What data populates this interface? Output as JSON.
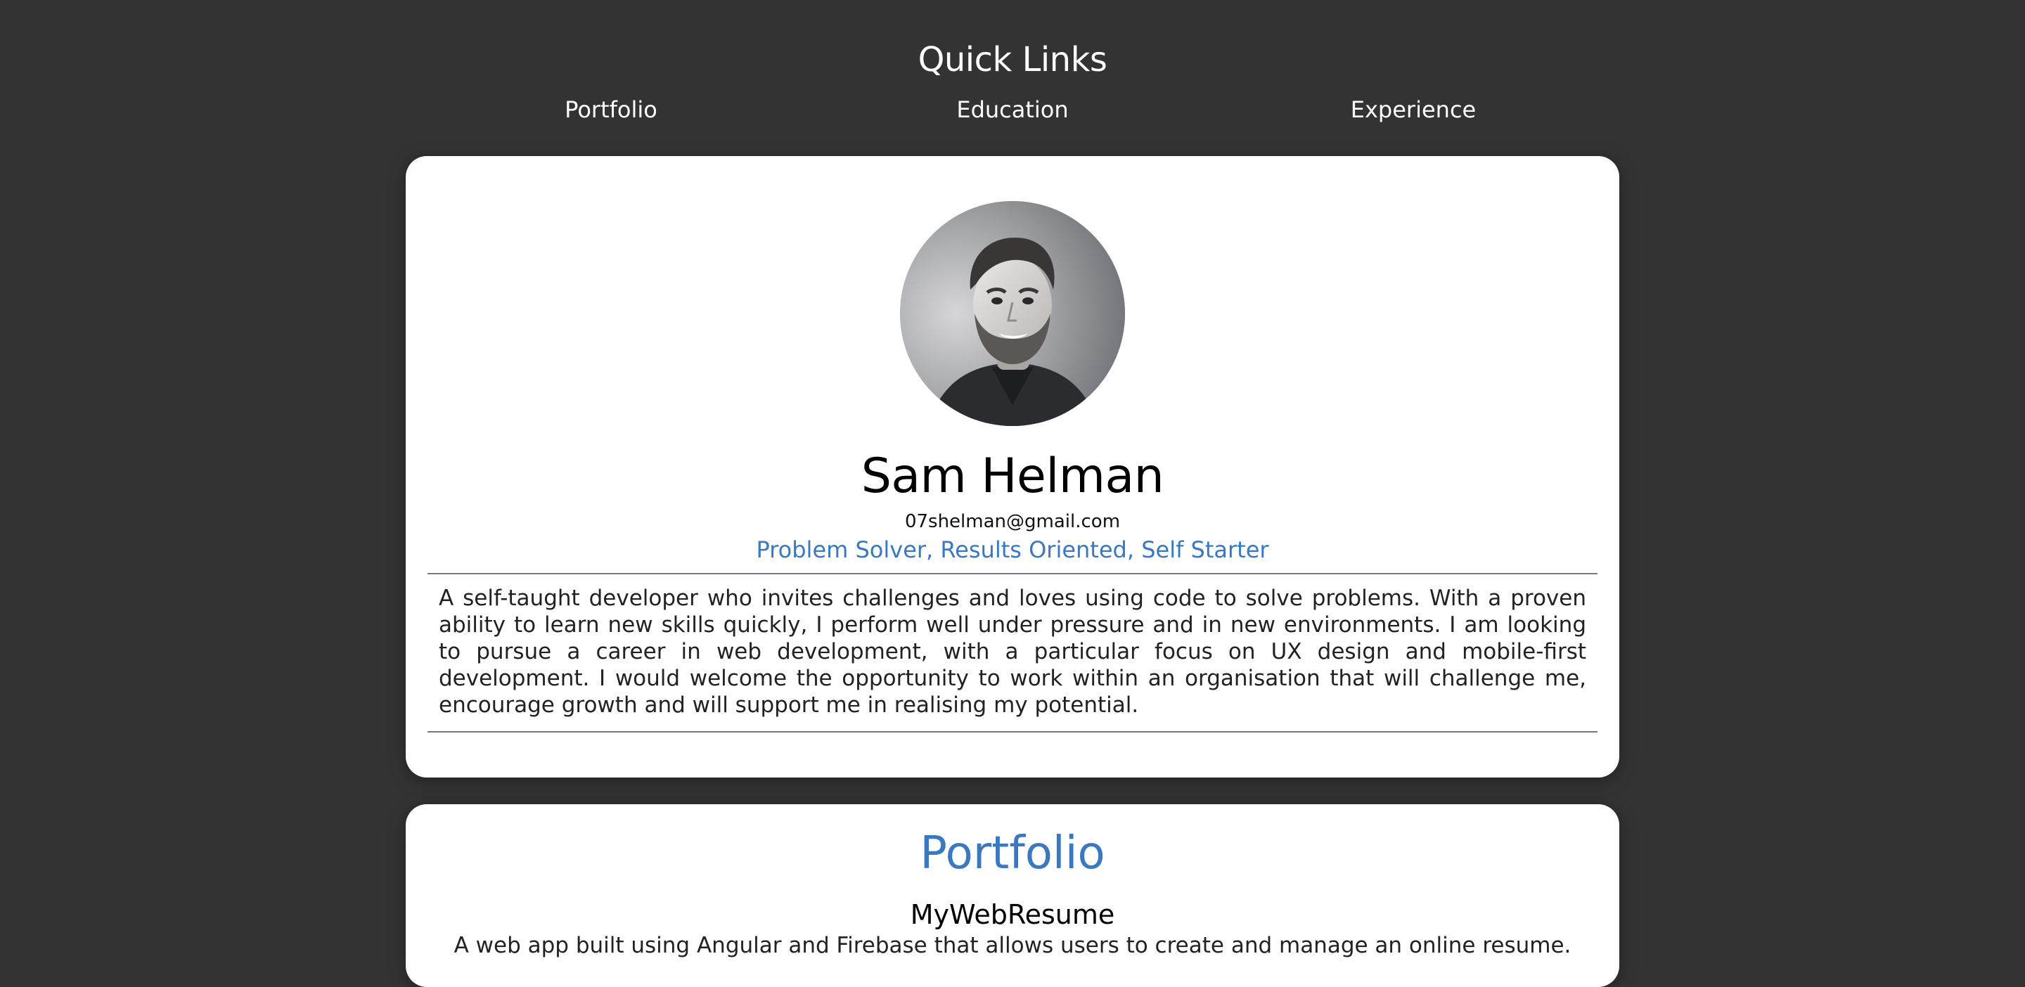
{
  "quick_links": {
    "title": "Quick Links",
    "items": [
      {
        "label": "Portfolio"
      },
      {
        "label": "Education"
      },
      {
        "label": "Experience"
      }
    ]
  },
  "profile": {
    "avatar_icon": "profile-photo",
    "name": "Sam Helman",
    "email": "07shelman@gmail.com",
    "tagline": "Problem Solver, Results Oriented, Self Starter",
    "bio": "A self-taught developer who invites challenges and loves using code to solve problems. With a proven ability to learn new skills quickly, I perform well under pressure and in new environments. I am looking to pursue a career in web development, with a particular focus on UX design and mobile-first development. I would welcome the opportunity to work within an organisation that will challenge me, encourage growth and will support me in realising my potential."
  },
  "portfolio": {
    "title": "Portfolio",
    "projects": [
      {
        "title": "MyWebResume",
        "description": "A web app built using Angular and Firebase that allows users to create and manage an online resume."
      }
    ]
  },
  "colors": {
    "background": "#333333",
    "card": "#ffffff",
    "accent": "#3a78c2"
  }
}
